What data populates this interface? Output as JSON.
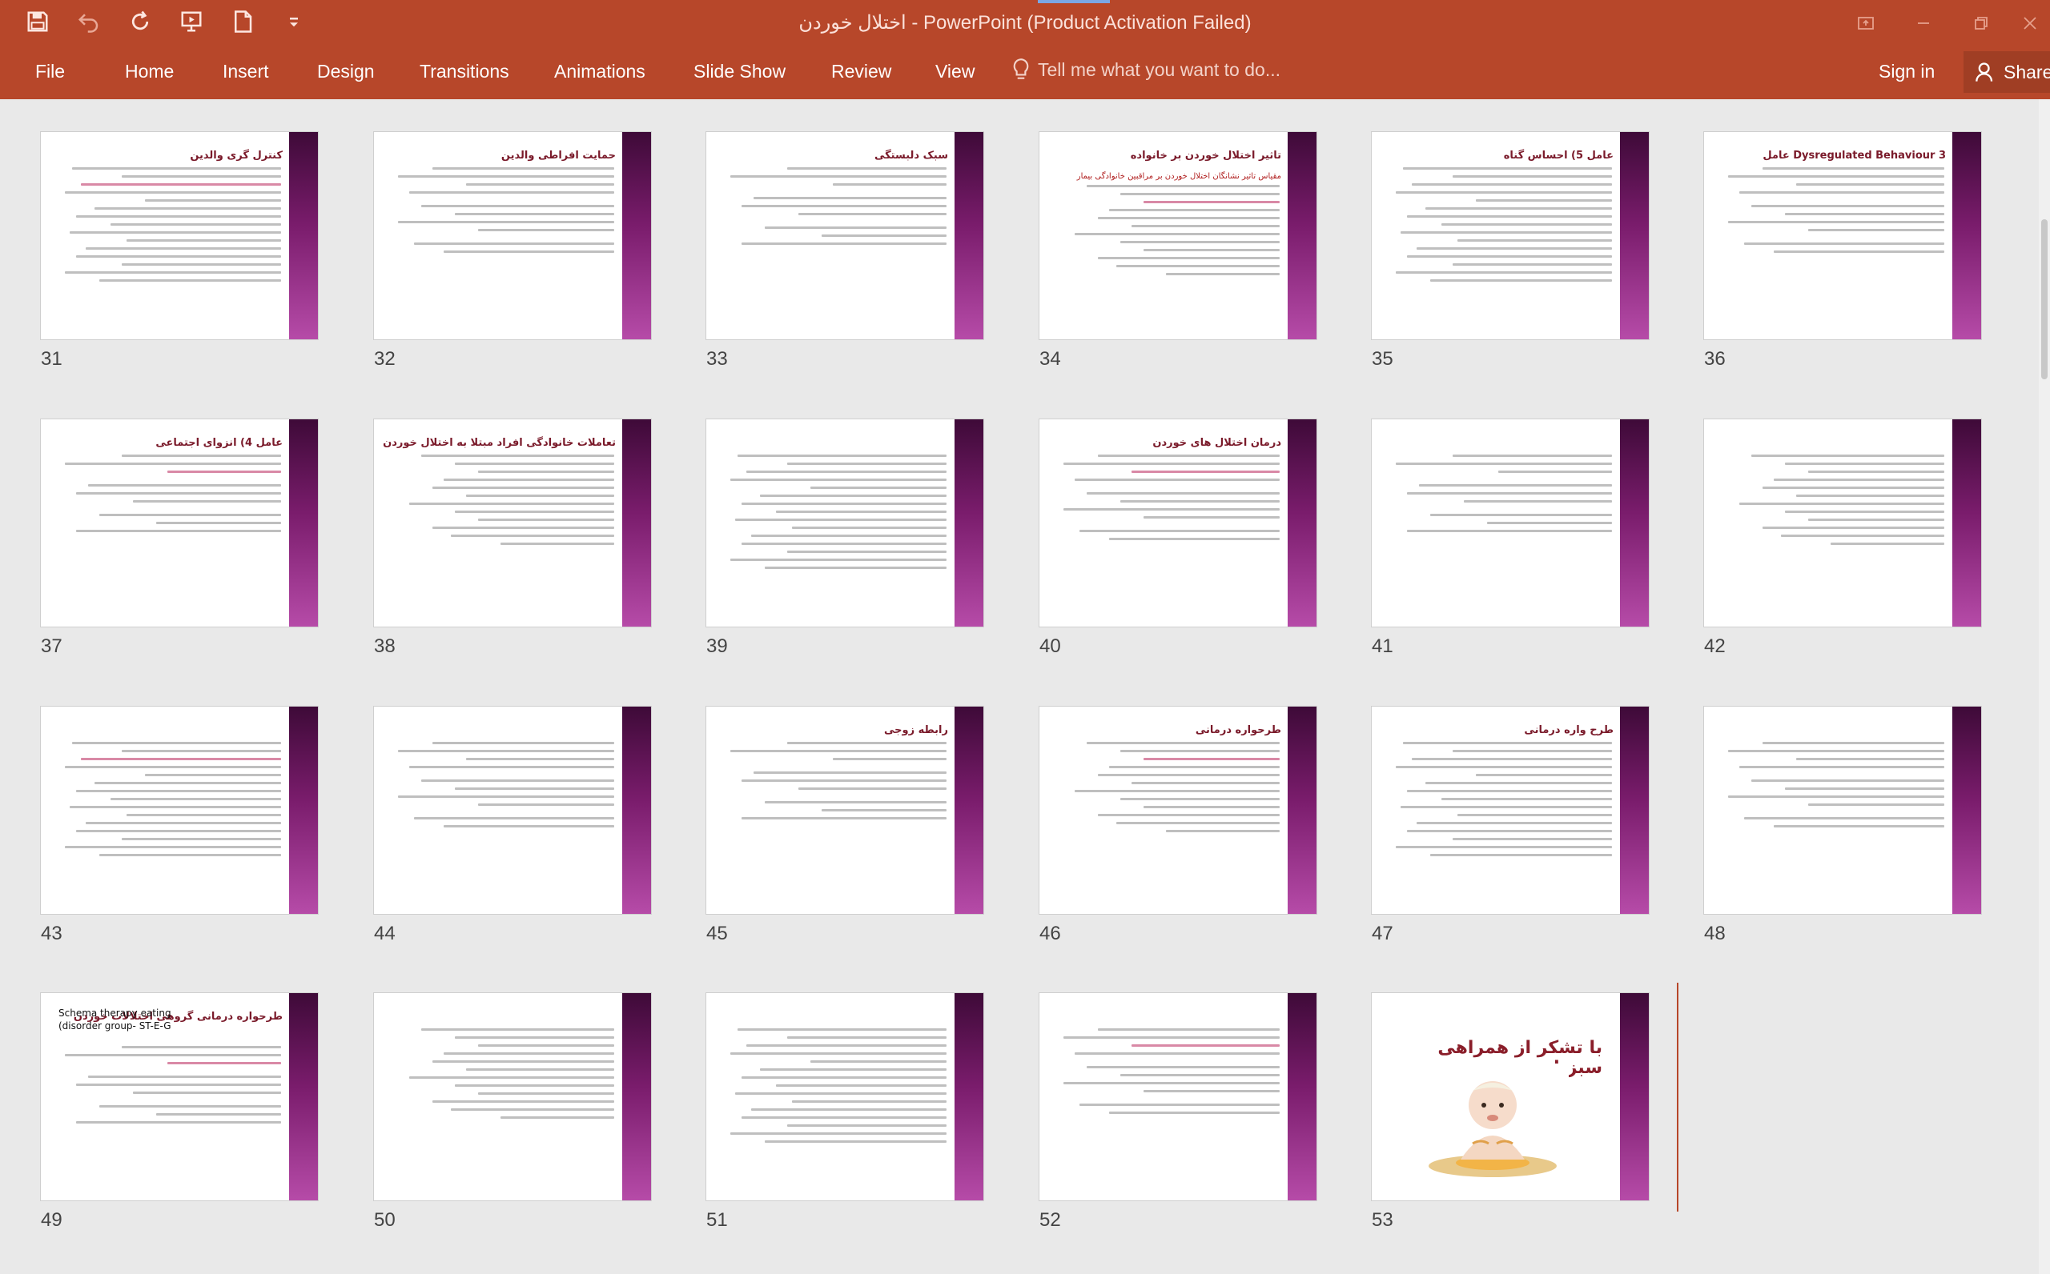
{
  "window": {
    "title": "اختلال خوردن - PowerPoint (Product Activation Failed)",
    "accent": "#b7472a"
  },
  "qat": {
    "icons": [
      "save-icon",
      "undo-icon",
      "redo-icon",
      "present-from-beginning-icon",
      "new-file-icon",
      "customize-dropdown-icon"
    ]
  },
  "ribbon": {
    "tabs": [
      "File",
      "Home",
      "Insert",
      "Design",
      "Transitions",
      "Animations",
      "Slide Show",
      "Review",
      "View"
    ],
    "tell_me": "Tell me what you want to do...",
    "sign_in": "Sign in",
    "share": "Share"
  },
  "slides": [
    {
      "number": "31",
      "title": "کنترل گری والدین"
    },
    {
      "number": "32",
      "title": "حمایت افراطی والدین"
    },
    {
      "number": "33",
      "title": "سبک دلبستگی"
    },
    {
      "number": "34",
      "title": "تاثیر اختلال خوردن بر خانواده",
      "subtitle": "مقیاس تاثیر نشانگان اختلال خوردن بر مراقبین خانوادگی بیمار"
    },
    {
      "number": "35",
      "title": "عامل 5) احساس گناه"
    },
    {
      "number": "36",
      "title": "Dysregulated Behaviour 3 عامل"
    },
    {
      "number": "37",
      "title": "عامل 4) انزوای اجتماعی"
    },
    {
      "number": "38",
      "title": "تعاملات خانوادگی افراد مبتلا به اختلال خوردن"
    },
    {
      "number": "39",
      "title": ""
    },
    {
      "number": "40",
      "title": "درمان اختلال های خوردن"
    },
    {
      "number": "41",
      "title": ""
    },
    {
      "number": "42",
      "title": ""
    },
    {
      "number": "43",
      "title": ""
    },
    {
      "number": "44",
      "title": ""
    },
    {
      "number": "45",
      "title": "رابطه زوجی"
    },
    {
      "number": "46",
      "title": "طرحواره درمانی"
    },
    {
      "number": "47",
      "title": "طرح واره درمانی"
    },
    {
      "number": "48",
      "title": ""
    },
    {
      "number": "49",
      "title": "طرحواره درمانی گروهی اختلالات خوردن",
      "ltitle": "Schema therapy eating",
      "ltitle2": "(disorder group- ST-E-G"
    },
    {
      "number": "50",
      "title": ""
    },
    {
      "number": "51",
      "title": ""
    },
    {
      "number": "52",
      "title": ""
    },
    {
      "number": "53",
      "title": "با تشکر از همراهی سبزتان"
    }
  ]
}
